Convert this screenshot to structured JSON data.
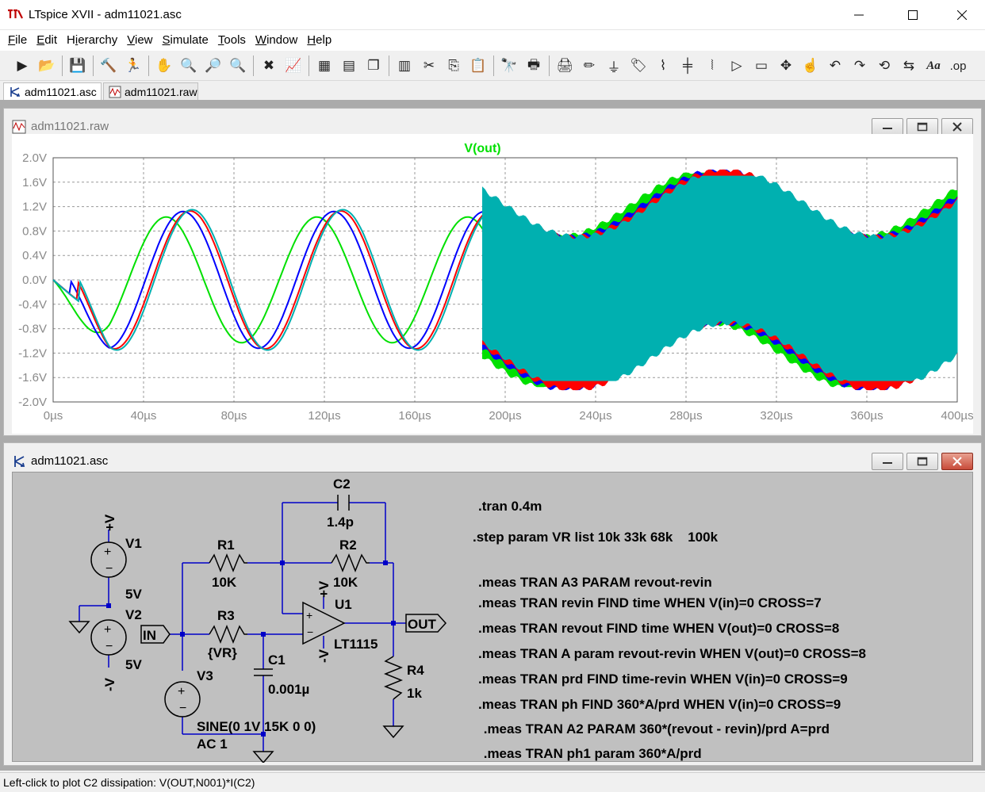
{
  "window": {
    "title": "LTspice XVII - adm11021.asc"
  },
  "menu": [
    "File",
    "Edit",
    "Hierarchy",
    "View",
    "Simulate",
    "Tools",
    "Window",
    "Help"
  ],
  "menu_underline": [
    "F",
    "E",
    "i",
    "V",
    "S",
    "T",
    "W",
    "H"
  ],
  "tabs": [
    {
      "label": "adm11021.asc"
    },
    {
      "label": "adm11021.raw"
    }
  ],
  "plot_window": {
    "title": "adm11021.raw",
    "trace_label": "V(out)",
    "trace_label_color": "#00e000"
  },
  "chart_data": {
    "type": "line",
    "xlabel": "",
    "ylabel": "",
    "xlim": [
      0,
      400
    ],
    "ylim": [
      -2.0,
      2.0
    ],
    "grid": true,
    "x_ticks": [
      "0µs",
      "40µs",
      "80µs",
      "120µs",
      "160µs",
      "200µs",
      "240µs",
      "280µs",
      "320µs",
      "360µs",
      "400µs"
    ],
    "y_ticks": [
      "2.0V",
      "1.6V",
      "1.2V",
      "0.8V",
      "0.4V",
      "0.0V",
      "-0.4V",
      "-0.8V",
      "-1.2V",
      "-1.6V",
      "-2.0V"
    ],
    "series": [
      {
        "color": "#00e000",
        "stable_amplitude": 1.03,
        "stable_phase_us": 0,
        "osc_low": -1.75,
        "osc_high": 1.75,
        "osc_edge_us": 0
      },
      {
        "color": "#0000ff",
        "stable_amplitude": 1.12,
        "stable_phase_us": 7.5,
        "osc_low": -1.8,
        "osc_high": 1.8,
        "osc_edge_us": 5
      },
      {
        "color": "#ff0000",
        "stable_amplitude": 1.13,
        "stable_phase_us": 10.5,
        "osc_low": -1.8,
        "osc_high": 1.8,
        "osc_edge_us": 7
      },
      {
        "color": "#00b0b0",
        "stable_amplitude": 1.15,
        "stable_phase_us": 11.5,
        "osc_low": -1.65,
        "osc_high": 1.7,
        "osc_edge_us": 9
      }
    ],
    "stable_period_us": 66.67,
    "oscillation_onset_us": 190,
    "slow_period_us": 133.3
  },
  "schematic_window": {
    "title": "adm11021.asc",
    "components": {
      "v1": "V1",
      "v1_val": "5V",
      "v2": "V2",
      "v2_val": "5V",
      "v3": "V3",
      "v3_val": "SINE(0 1V 15K 0 0)",
      "v3_ac": "AC 1",
      "r1": "R1",
      "r1_val": "10K",
      "r2": "R2",
      "r2_val": "10K",
      "r3": "R3",
      "r3_val": "{VR}",
      "r4": "R4",
      "r4_val": "1k",
      "c1": "C1",
      "c1_val": "0.001µ",
      "c2": "C2",
      "c2_val": "1.4p",
      "u1": "U1",
      "u1_val": "LT1115",
      "in_label": "IN",
      "out_label": "OUT",
      "vplus": "+V",
      "vminus": "-V"
    },
    "directives": [
      ".tran 0.4m",
      ".step param VR list 10k 33k 68k    100k",
      ".meas TRAN A3 PARAM revout-revin",
      ".meas TRAN revin FIND time WHEN V(in)=0 CROSS=7",
      ".meas TRAN revout FIND time WHEN V(out)=0 CROSS=8",
      ".meas TRAN A param revout-revin WHEN V(out)=0 CROSS=8",
      ".meas TRAN prd FIND time-revin WHEN V(in)=0 CROSS=9",
      ".meas TRAN ph FIND 360*A/prd WHEN V(in)=0 CROSS=9",
      " .meas TRAN A2 PARAM 360*(revout - revin)/prd A=prd",
      " .meas TRAN ph1 param 360*A/prd"
    ]
  },
  "status": {
    "text": "Left-click to plot C2 dissipation: V(OUT,N001)*I(C2)"
  },
  "toolbar_icons": [
    "run-icon",
    "open-icon",
    "save-icon",
    "control-panel-icon",
    "halt-icon",
    "pan-icon",
    "zoom-in-icon",
    "zoom-full-icon",
    "zoom-out-icon",
    "zoom-cancel-icon",
    "autorange-icon",
    "grid-icon",
    "tile-horizontal-icon",
    "cascade-icon",
    "tile-vertical-icon",
    "cut-icon",
    "copy-icon",
    "paste-icon",
    "find-icon",
    "print-preview-icon",
    "print-icon",
    "wire-icon",
    "ground-icon",
    "label-icon",
    "resistor-icon",
    "capacitor-icon",
    "inductor-icon",
    "diode-icon",
    "component-icon",
    "move-icon",
    "drag-icon",
    "undo-icon",
    "redo-icon",
    "rotate-icon",
    "mirror-icon",
    "text-icon",
    "spice-directive-icon"
  ],
  "colors": {
    "mdi_bg": "#ababab",
    "schematic_bg": "#c0c0c0",
    "wire": "#0000c8",
    "component": "#000000"
  }
}
